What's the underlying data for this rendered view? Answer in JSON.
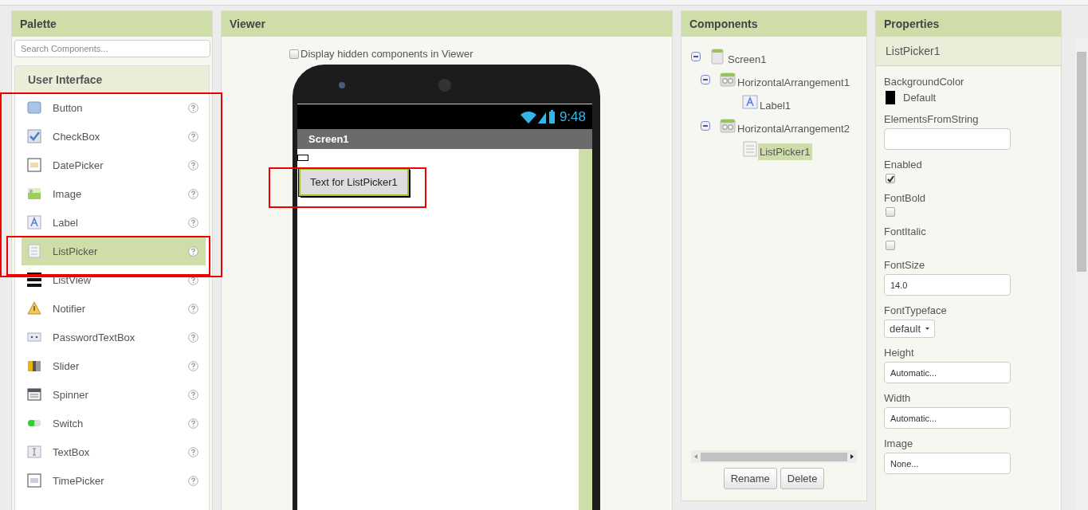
{
  "palette": {
    "title": "Palette",
    "search": {
      "placeholder": "Search Components..."
    },
    "section": "User Interface",
    "items": [
      {
        "label": "Button",
        "selected": false
      },
      {
        "label": "CheckBox",
        "selected": false
      },
      {
        "label": "DatePicker",
        "selected": false
      },
      {
        "label": "Image",
        "selected": false
      },
      {
        "label": "Label",
        "selected": false
      },
      {
        "label": "ListPicker",
        "selected": true
      },
      {
        "label": "ListView",
        "selected": false
      },
      {
        "label": "Notifier",
        "selected": false
      },
      {
        "label": "PasswordTextBox",
        "selected": false
      },
      {
        "label": "Slider",
        "selected": false
      },
      {
        "label": "Spinner",
        "selected": false
      },
      {
        "label": "Switch",
        "selected": false
      },
      {
        "label": "TextBox",
        "selected": false
      },
      {
        "label": "TimePicker",
        "selected": false
      }
    ]
  },
  "viewer": {
    "title": "Viewer",
    "hidden_toggle": {
      "label": "Display hidden components in Viewer",
      "checked": false
    },
    "phone": {
      "time": "9:48",
      "screen_title": "Screen1",
      "button_label": "Text for ListPicker1"
    }
  },
  "components": {
    "title": "Components",
    "tree": [
      {
        "label": "Screen1",
        "kind": "screen",
        "selected": false,
        "expanded": true,
        "children": [
          {
            "label": "HorizontalArrangement1",
            "kind": "arrangement",
            "selected": false,
            "expanded": true,
            "children": [
              {
                "label": "Label1",
                "kind": "label",
                "selected": false
              }
            ]
          },
          {
            "label": "HorizontalArrangement2",
            "kind": "arrangement",
            "selected": false,
            "expanded": true,
            "children": [
              {
                "label": "ListPicker1",
                "kind": "listpicker",
                "selected": true
              }
            ]
          }
        ]
      }
    ],
    "buttons": [
      "Rename",
      "Delete"
    ]
  },
  "properties": {
    "title": "Properties",
    "component": "ListPicker1",
    "items": [
      {
        "kind": "color",
        "label": "BackgroundColor",
        "value": "Default",
        "color": "#000000"
      },
      {
        "kind": "text",
        "label": "ElementsFromString"
      },
      {
        "kind": "checkbox",
        "label": "Enabled",
        "checked": true
      },
      {
        "kind": "checkbox",
        "label": "FontBold",
        "checked": false
      },
      {
        "kind": "checkbox",
        "label": "FontItalic",
        "checked": false
      },
      {
        "kind": "text",
        "label": "FontSize",
        "value": "14.0"
      },
      {
        "kind": "dropdown",
        "label": "FontTypeface",
        "value": "default"
      },
      {
        "kind": "text",
        "label": "Height",
        "value": "Automatic..."
      },
      {
        "kind": "text",
        "label": "Width",
        "value": "Automatic..."
      },
      {
        "kind": "text",
        "label": "Image",
        "value": "None..."
      }
    ]
  }
}
